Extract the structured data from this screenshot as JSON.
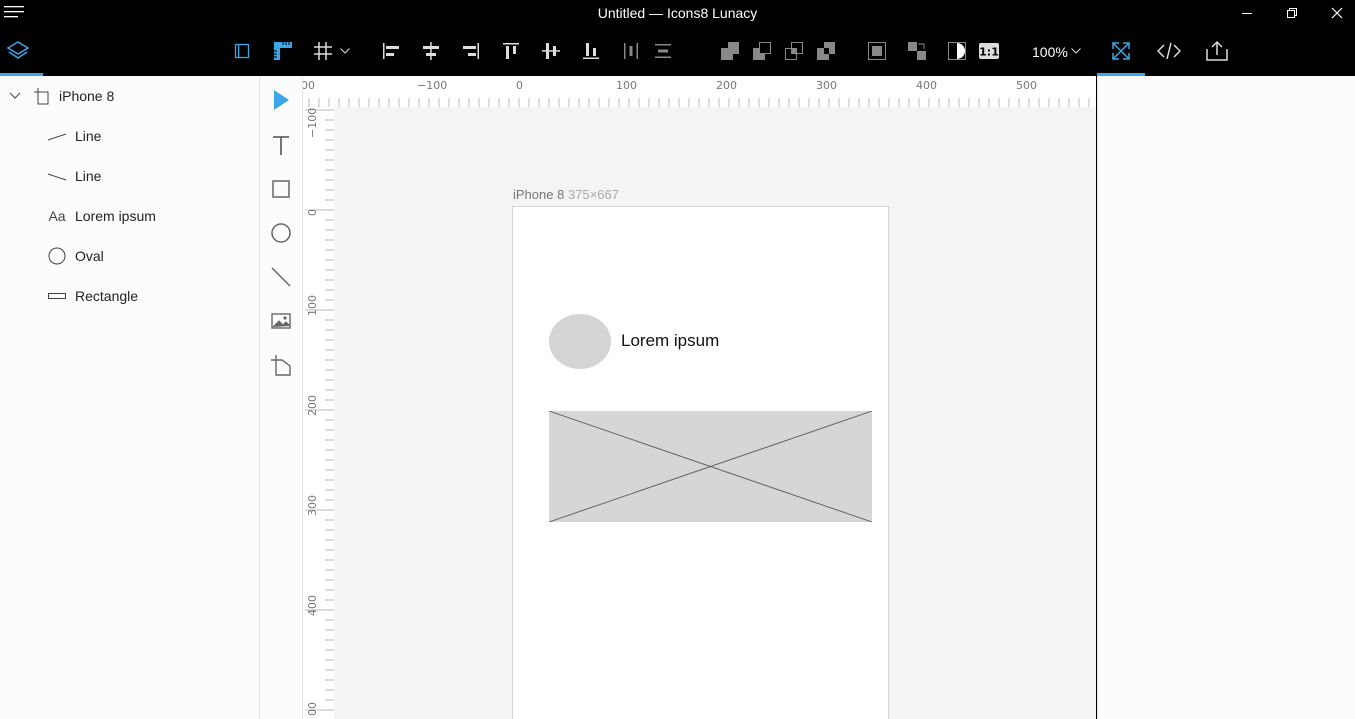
{
  "window": {
    "title": "Untitled — Icons8 Lunacy"
  },
  "toolbar": {
    "zoom": "100%"
  },
  "layers": {
    "root": "iPhone 8",
    "items": [
      {
        "label": "Line",
        "icon": "line-up-icon"
      },
      {
        "label": "Line",
        "icon": "line-down-icon"
      },
      {
        "label": "Lorem ipsum",
        "icon": "text-layer-icon",
        "icon_text": "Aa"
      },
      {
        "label": "Oval",
        "icon": "oval-layer-icon"
      },
      {
        "label": "Rectangle",
        "icon": "rectangle-layer-icon"
      }
    ]
  },
  "ruler": {
    "h_labels": [
      "00",
      "−100",
      "0",
      "100",
      "200",
      "300",
      "400",
      "500"
    ],
    "v_labels": [
      "−100",
      "0",
      "100",
      "200",
      "300",
      "400",
      "00"
    ]
  },
  "canvas": {
    "artboard_name": "iPhone 8",
    "artboard_size": "375×667",
    "text_layer": "Lorem ipsum"
  },
  "colors": {
    "accent": "#3ba6e8",
    "toolbar_bg": "#000000",
    "canvas_bg": "#f4f4f4",
    "shape_fill": "#d4d4d4"
  }
}
